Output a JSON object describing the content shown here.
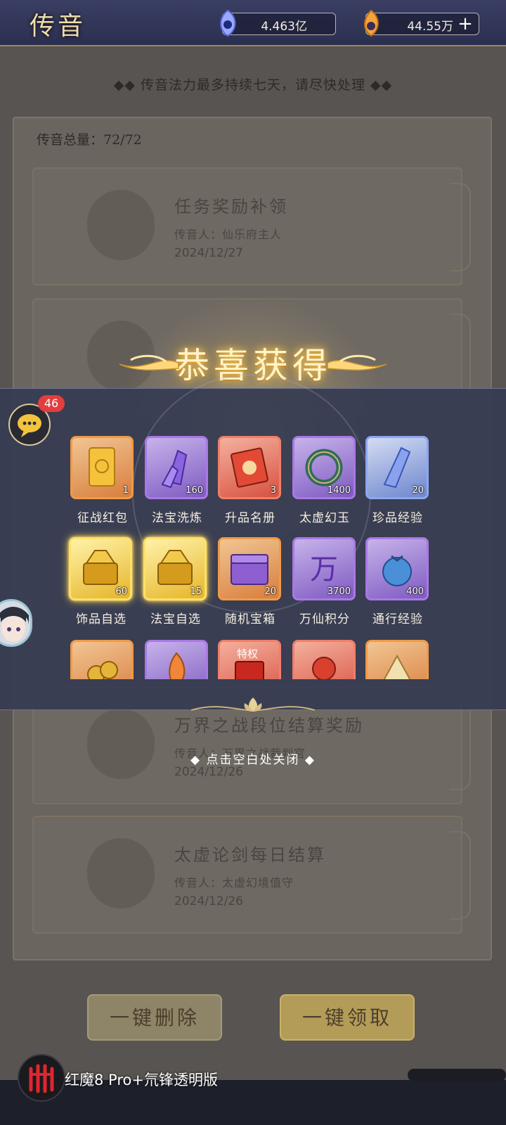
{
  "header": {
    "title": "传音",
    "jade_amount": "4.463亿",
    "gold_amount": "44.55万",
    "add_label": "+"
  },
  "notice": "◆◆ 传音法力最多持续七天，请尽快处理 ◆◆",
  "mail_total": "传音总量：72/72",
  "mails": [
    {
      "title": "任务奖励补领",
      "sender": "传音人：仙乐府主人",
      "date": "2024/12/27"
    },
    {
      "title": "万界之战段位结算奖励",
      "sender": "传音人：万界之战裁判官",
      "date": "2024/12/26"
    },
    {
      "title": "太虚论剑每日结算",
      "sender": "传音人：太虚幻境值守",
      "date": "2024/12/26"
    }
  ],
  "buttons": {
    "delete_all": "一键删除",
    "claim_all": "一键领取"
  },
  "reward": {
    "title": "恭喜获得",
    "close_hint": "◆ 点击空白处关闭 ◆",
    "items": [
      {
        "name": "征战红包",
        "qty": "1",
        "quality": "orange",
        "icon": "red-envelope-icon"
      },
      {
        "name": "法宝洗炼",
        "qty": "160",
        "quality": "purple",
        "icon": "crystal-icon"
      },
      {
        "name": "升品名册",
        "qty": "3",
        "quality": "red",
        "icon": "scroll-icon"
      },
      {
        "name": "太虚幻玉",
        "qty": "1400",
        "quality": "purple",
        "icon": "jade-ring-icon"
      },
      {
        "name": "珍品经验",
        "qty": "20",
        "quality": "blue",
        "icon": "crystal-shard-icon"
      },
      {
        "name": "饰品自选",
        "qty": "60",
        "quality": "gold",
        "icon": "gold-chest-icon"
      },
      {
        "name": "法宝自选",
        "qty": "15",
        "quality": "gold",
        "icon": "gold-chest-icon"
      },
      {
        "name": "随机宝箱",
        "qty": "20",
        "quality": "orange",
        "icon": "purple-chest-icon"
      },
      {
        "name": "万仙积分",
        "qty": "3700",
        "quality": "purple",
        "icon": "wan-token-icon"
      },
      {
        "name": "通行经验",
        "qty": "400",
        "quality": "purple",
        "icon": "blue-pouch-icon"
      },
      {
        "name": "",
        "qty": "",
        "quality": "orange",
        "icon": "coins-icon"
      },
      {
        "name": "",
        "qty": "",
        "quality": "purple",
        "icon": "flame-icon"
      },
      {
        "name": "",
        "qty": "",
        "quality": "red",
        "icon": "privilege-box-icon"
      },
      {
        "name": "",
        "qty": "",
        "quality": "red",
        "icon": "red-scroll-icon"
      },
      {
        "name": "",
        "qty": "",
        "quality": "orange",
        "icon": "fan-icon"
      }
    ],
    "privilege_label": "特权",
    "wan_glyph": "万"
  },
  "chat": {
    "badge": "46"
  },
  "watermark": "红魔8 Pro+氘锋透明版",
  "colors": {
    "accent_gold": "#f0dca8",
    "badge_red": "#e23e3e",
    "overlay_band": "#363c52"
  }
}
